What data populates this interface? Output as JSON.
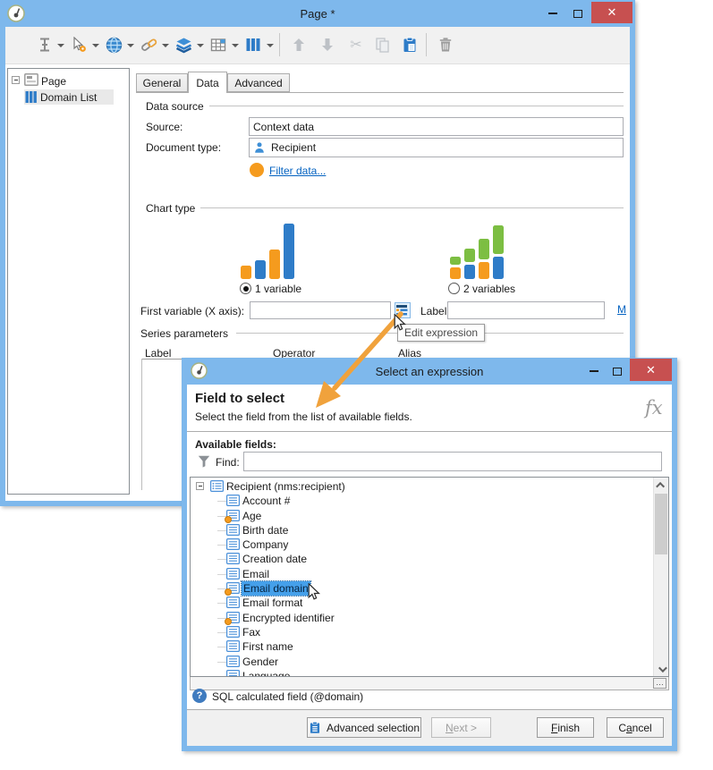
{
  "colors": {
    "window_chrome": "#7EB8EC",
    "close_red": "#C75050",
    "accent_blue": "#2E7CC8",
    "bar_orange": "#F59B1E",
    "bar_green": "#7CBE42",
    "arrow_orange": "#F0A23C",
    "link_blue": "#0563C1",
    "selection_blue": "#45A0EA"
  },
  "glyphs": {
    "close": "✕",
    "minimize": "–",
    "scissors": "✂",
    "help": "?",
    "fx": "fx",
    "ellipsis": "…"
  },
  "main_window": {
    "title": "Page *",
    "tree": {
      "page_label": "Page",
      "domain_label": "Domain List"
    },
    "tabs": [
      {
        "label": "General",
        "active": false
      },
      {
        "label": "Data",
        "active": true
      },
      {
        "label": "Advanced",
        "active": false
      }
    ],
    "form": {
      "data_source_group": "Data source",
      "source_label": "Source:",
      "source_value": "Context data",
      "doc_type_label": "Document type:",
      "doc_type_value": "Recipient",
      "filter_link": "Filter data...",
      "chart_type_group": "Chart type",
      "option_1": "1 variable",
      "option_2": "2 variables",
      "first_var_label": "First variable (X axis):",
      "first_var_value": "",
      "axis_label": "Label:",
      "axis_label_value": "",
      "m_link": "M",
      "series_group": "Series parameters",
      "series_columns": [
        "Label",
        "Operator",
        "Alias"
      ]
    },
    "tooltip": "Edit expression"
  },
  "dialog": {
    "title": "Select an expression",
    "heading": "Field to select",
    "subheading": "Select the field from the list of available fields.",
    "available_label": "Available fields:",
    "find_label": "Find:",
    "find_value": "",
    "root_label": "Recipient (nms:recipient)",
    "fields": [
      {
        "label": "Account #",
        "calc": false,
        "selected": false
      },
      {
        "label": "Age",
        "calc": true,
        "selected": false
      },
      {
        "label": "Birth date",
        "calc": false,
        "selected": false
      },
      {
        "label": "Company",
        "calc": false,
        "selected": false
      },
      {
        "label": "Creation date",
        "calc": false,
        "selected": false
      },
      {
        "label": "Email",
        "calc": false,
        "selected": false
      },
      {
        "label": "Email domain",
        "calc": true,
        "selected": true
      },
      {
        "label": "Email format",
        "calc": false,
        "selected": false
      },
      {
        "label": "Encrypted identifier",
        "calc": true,
        "selected": false
      },
      {
        "label": "Fax",
        "calc": false,
        "selected": false
      },
      {
        "label": "First name",
        "calc": false,
        "selected": false
      },
      {
        "label": "Gender",
        "calc": false,
        "selected": false
      },
      {
        "label": "Language",
        "calc": false,
        "selected": false
      }
    ],
    "status": "SQL calculated field (@domain)",
    "buttons": {
      "advanced_label": "Advanced selection",
      "next_key": "N",
      "next_post": "ext >",
      "finish_key": "F",
      "finish_post": "inish",
      "cancel_pre": "C",
      "cancel_key": "a",
      "cancel_post": "ncel"
    }
  }
}
